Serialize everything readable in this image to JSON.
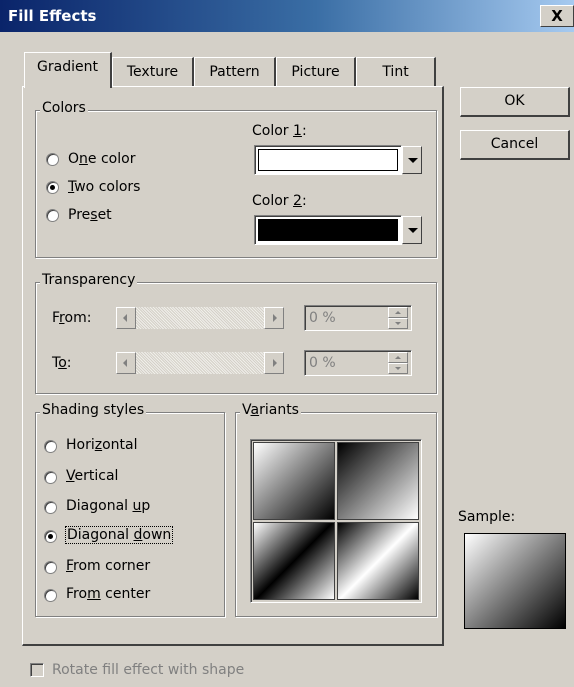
{
  "window": {
    "title": "Fill Effects",
    "close_glyph": "X"
  },
  "tabs": [
    {
      "label": "Gradient",
      "active": true
    },
    {
      "label": "Texture",
      "active": false
    },
    {
      "label": "Pattern",
      "active": false
    },
    {
      "label": "Picture",
      "active": false
    },
    {
      "label": "Tint",
      "active": false
    }
  ],
  "colors_group": {
    "legend": "Colors",
    "options": [
      {
        "pre": "O",
        "mnemonic": "n",
        "post": "e color",
        "selected": false
      },
      {
        "pre": "",
        "mnemonic": "T",
        "post": "wo colors",
        "selected": true
      },
      {
        "pre": "Pre",
        "mnemonic": "s",
        "post": "et",
        "selected": false
      }
    ],
    "color1": {
      "pre": "Color ",
      "mnemonic": "1",
      "post": ":",
      "value": "#ffffff"
    },
    "color2": {
      "pre": "Color ",
      "mnemonic": "2",
      "post": ":",
      "value": "#000000"
    }
  },
  "transparency": {
    "legend": "Transparency",
    "from": {
      "pre": "F",
      "mnemonic": "r",
      "post": "om:",
      "value": "0 %"
    },
    "to": {
      "pre": "T",
      "mnemonic": "o",
      "post": ":",
      "value": "0 %"
    }
  },
  "shading": {
    "legend": "Shading styles",
    "options": [
      {
        "pre": "Hori",
        "mnemonic": "z",
        "post": "ontal",
        "selected": false
      },
      {
        "pre": "",
        "mnemonic": "V",
        "post": "ertical",
        "selected": false
      },
      {
        "pre": "Diagonal ",
        "mnemonic": "u",
        "post": "p",
        "selected": false
      },
      {
        "pre": "Diagonal ",
        "mnemonic": "d",
        "post": "own",
        "selected": true
      },
      {
        "pre": "",
        "mnemonic": "F",
        "post": "rom corner",
        "selected": false
      },
      {
        "pre": "Fro",
        "mnemonic": "m",
        "post": " center",
        "selected": false
      }
    ]
  },
  "variants": {
    "pre": "V",
    "mnemonic": "a",
    "post": "riants"
  },
  "buttons": {
    "ok": "OK",
    "cancel": "Cancel"
  },
  "sample": {
    "label": "Sample:"
  },
  "rotate": {
    "label": "Rotate fill effect with shape",
    "checked": false,
    "enabled": false
  },
  "colors": {
    "dialog_bg": "#d4d0c8",
    "titlebar_start": "#0a246a",
    "titlebar_end": "#a6caf0"
  }
}
